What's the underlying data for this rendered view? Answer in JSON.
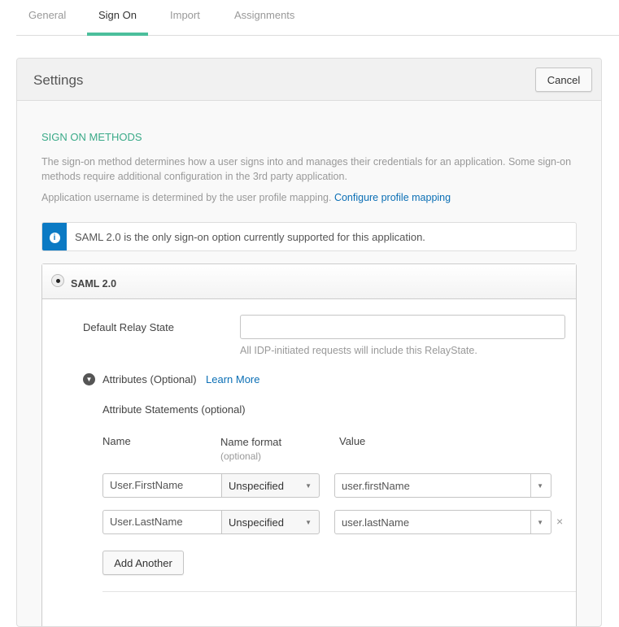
{
  "tabs": [
    {
      "label": "General"
    },
    {
      "label": "Sign On"
    },
    {
      "label": "Import"
    },
    {
      "label": "Assignments"
    }
  ],
  "panel": {
    "title": "Settings",
    "cancel": "Cancel"
  },
  "section": {
    "heading": "SIGN ON METHODS",
    "desc": "The sign-on method determines how a user signs into and manages their credentials for an application. Some sign-on methods require additional configuration in the 3rd party application.",
    "username_note": "Application username is determined by the user profile mapping.",
    "mapping_link": "Configure profile mapping",
    "info": "SAML 2.0 is the only sign-on option currently supported for this application."
  },
  "saml": {
    "label": "SAML 2.0",
    "relay_label": "Default Relay State",
    "relay_value": "",
    "relay_help": "All IDP-initiated requests will include this RelayState.",
    "attributes_label": "Attributes (Optional)",
    "learn_more": "Learn More",
    "statements_label": "Attribute Statements (optional)",
    "col_name": "Name",
    "col_format": "Name format",
    "col_format_sub": "(optional)",
    "col_value": "Value",
    "rows": [
      {
        "name": "User.FirstName",
        "format": "Unspecified",
        "value": "user.firstName"
      },
      {
        "name": "User.LastName",
        "format": "Unspecified",
        "value": "user.lastName"
      }
    ],
    "add_another": "Add Another"
  }
}
